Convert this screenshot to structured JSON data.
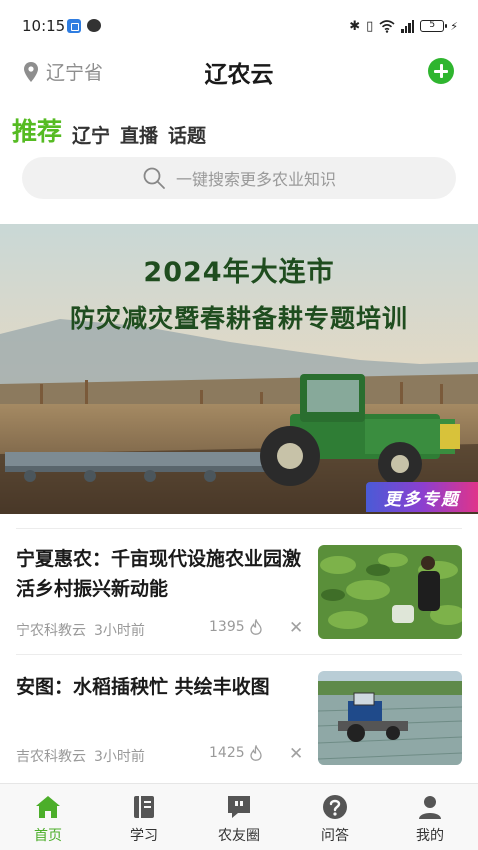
{
  "status_bar": {
    "time": "10:15",
    "battery": "5"
  },
  "header": {
    "location": "辽宁省",
    "title": "辽农云"
  },
  "tabs": [
    {
      "label": "推荐",
      "active": true
    },
    {
      "label": "辽宁",
      "active": false
    },
    {
      "label": "直播",
      "active": false
    },
    {
      "label": "话题",
      "active": false
    }
  ],
  "search": {
    "placeholder": "一键搜索更多农业知识"
  },
  "banner": {
    "title_line1": "2024年大连市",
    "title_line2": "防灾减灾暨春耕备耕专题培训",
    "more_label": "更多专题"
  },
  "news": [
    {
      "title": "宁夏惠农：千亩现代设施农业园激活乡村振兴新动能",
      "source": "宁农科教云",
      "time": "3小时前",
      "count": "1395"
    },
    {
      "title": "安图：水稻插秧忙 共绘丰收图",
      "source": "吉农科教云",
      "time": "3小时前",
      "count": "1425"
    }
  ],
  "bottom_nav": [
    {
      "label": "首页",
      "icon": "home-icon",
      "active": true
    },
    {
      "label": "学习",
      "icon": "book-icon",
      "active": false
    },
    {
      "label": "农友圈",
      "icon": "quote-bubble-icon",
      "active": false
    },
    {
      "label": "问答",
      "icon": "question-icon",
      "active": false
    },
    {
      "label": "我的",
      "icon": "user-icon",
      "active": false
    }
  ],
  "colors": {
    "accent": "#55bb22",
    "add_button": "#2fb52f",
    "nav_active": "#4cae2a"
  }
}
